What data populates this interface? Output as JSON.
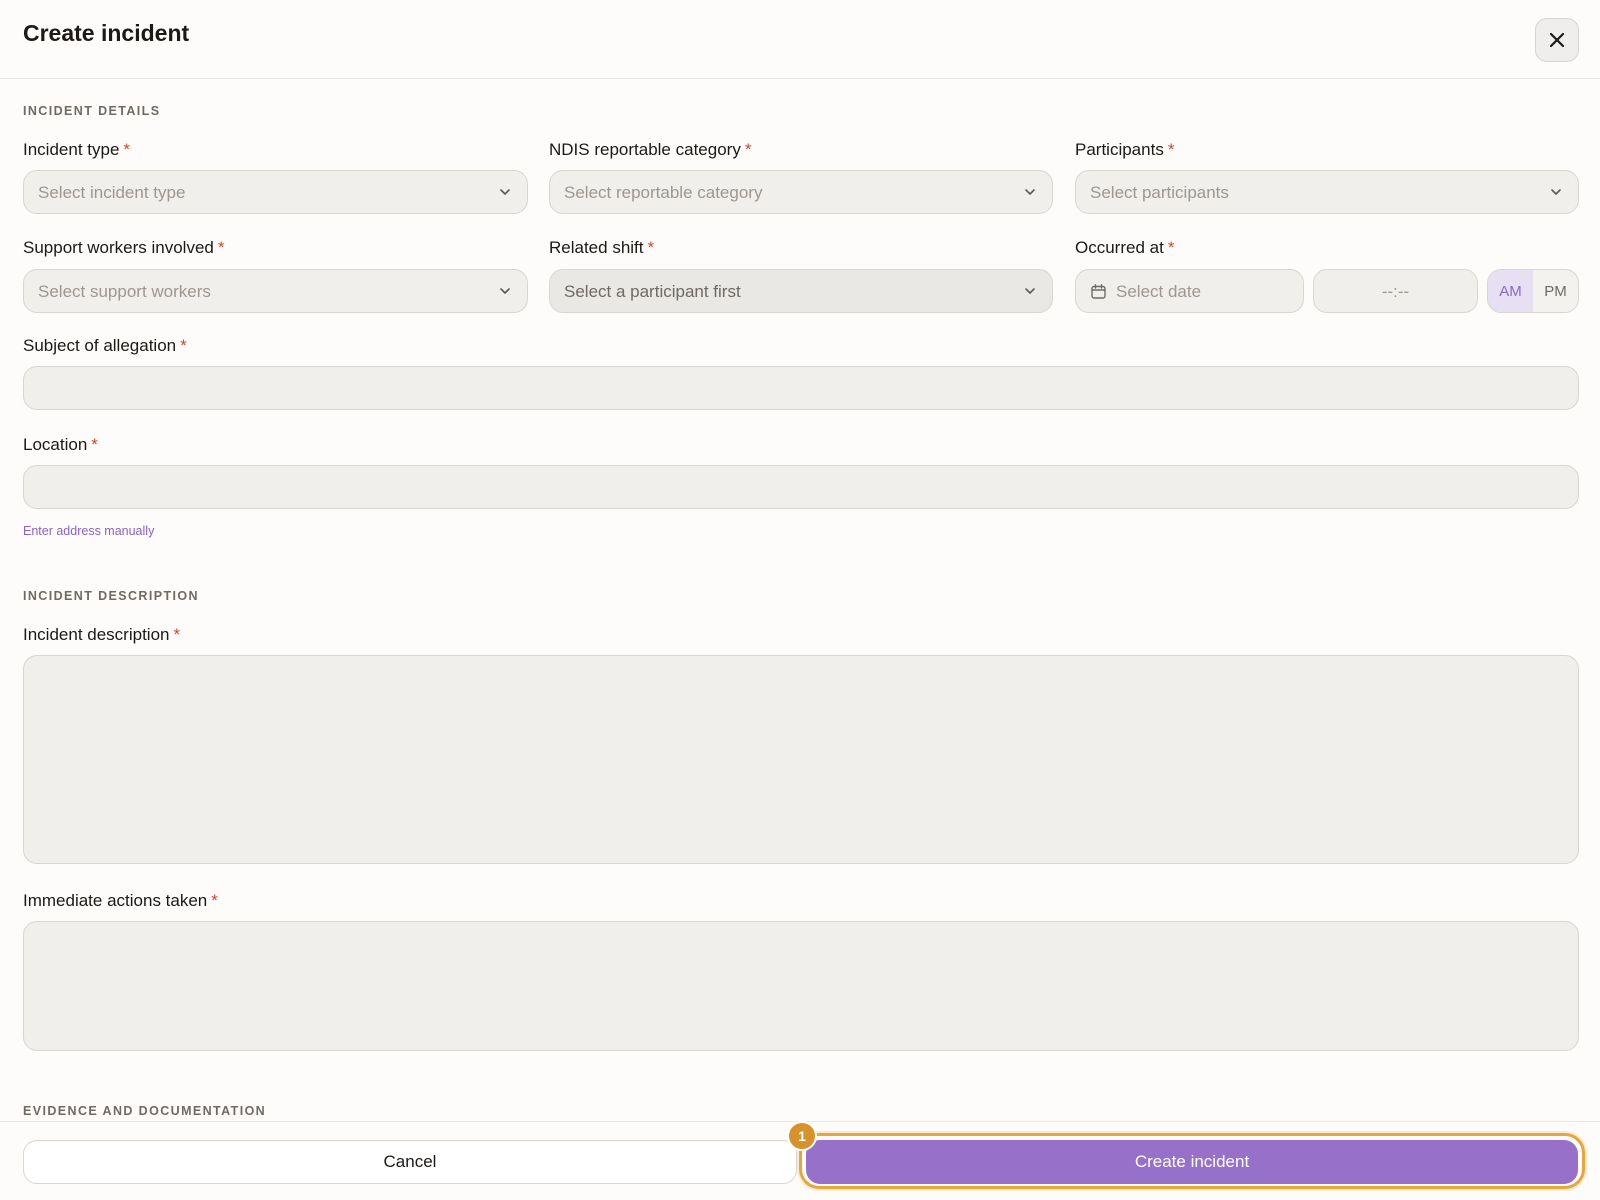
{
  "dialog": {
    "title": "Create incident"
  },
  "sections": {
    "details": "INCIDENT DETAILS",
    "description": "INCIDENT DESCRIPTION",
    "evidence": "EVIDENCE AND DOCUMENTATION"
  },
  "fields": {
    "incident_type": {
      "label": "Incident type",
      "placeholder": "Select incident type"
    },
    "ndis_category": {
      "label": "NDIS reportable category",
      "placeholder": "Select reportable category"
    },
    "participants": {
      "label": "Participants",
      "placeholder": "Select participants"
    },
    "support_workers": {
      "label": "Support workers involved",
      "placeholder": "Select support workers"
    },
    "related_shift": {
      "label": "Related shift",
      "placeholder": "Select a participant first"
    },
    "occurred_at": {
      "label": "Occurred at",
      "date_placeholder": "Select date",
      "time_placeholder": "--:--",
      "am": "AM",
      "pm": "PM",
      "selected_period": "AM"
    },
    "subject_of_allegation": {
      "label": "Subject of allegation",
      "value": ""
    },
    "location": {
      "label": "Location",
      "value": "",
      "manual_link": "Enter address manually"
    },
    "incident_description": {
      "label": "Incident description",
      "value": ""
    },
    "immediate_actions": {
      "label": "Immediate actions taken",
      "value": ""
    }
  },
  "required_marker": "*",
  "footer": {
    "cancel": "Cancel",
    "create": "Create incident",
    "badge": "1"
  },
  "colors": {
    "accent": "#9670c9",
    "required": "#d4462f",
    "highlight": "#e5a73d",
    "badge": "#d7922b"
  },
  "icons": {
    "close": "close-icon",
    "chevron": "chevron-down-icon",
    "calendar": "calendar-icon"
  }
}
